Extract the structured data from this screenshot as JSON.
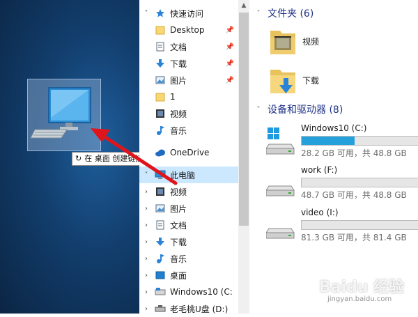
{
  "desktop": {
    "tooltip_glyph": "↻",
    "tooltip_text": "在 桌面 创建链接"
  },
  "nav": {
    "quick_access": "快速访问",
    "pinned": [
      {
        "label": "Desktop",
        "icon": "folder-icon"
      },
      {
        "label": "文档",
        "icon": "document-icon"
      },
      {
        "label": "下载",
        "icon": "download-icon"
      },
      {
        "label": "图片",
        "icon": "pictures-icon"
      }
    ],
    "recent": [
      {
        "label": "1",
        "icon": "folder-icon"
      },
      {
        "label": "视频",
        "icon": "video-icon"
      },
      {
        "label": "音乐",
        "icon": "music-icon"
      }
    ],
    "onedrive": "OneDrive",
    "this_pc": "此电脑",
    "pc_children": [
      {
        "label": "视频",
        "icon": "video-icon"
      },
      {
        "label": "图片",
        "icon": "pictures-icon"
      },
      {
        "label": "文档",
        "icon": "document-icon"
      },
      {
        "label": "下载",
        "icon": "download-icon"
      },
      {
        "label": "音乐",
        "icon": "music-icon"
      },
      {
        "label": "桌面",
        "icon": "desktop-icon"
      },
      {
        "label": "Windows10 (C:",
        "icon": "drive-icon"
      },
      {
        "label": "老毛桃U盘 (D:)",
        "icon": "usb-drive-icon"
      }
    ]
  },
  "content": {
    "folders_header": "文件夹 (6)",
    "folders": [
      {
        "label": "视频",
        "icon": "video-folder-icon"
      },
      {
        "label": "下载",
        "icon": "download-folder-icon"
      }
    ],
    "devices_header": "设备和驱动器 (8)",
    "drives": [
      {
        "name": "Windows10 (C:)",
        "info": "28.2 GB 可用，共 48.8 GB",
        "used_fraction": 0.42,
        "icon": "windows-drive-icon"
      },
      {
        "name": "work (F:)",
        "info": "48.7 GB 可用，共 48.8 GB",
        "used_fraction": 0.0,
        "icon": "hard-drive-icon"
      },
      {
        "name": "video (I:)",
        "info": "81.3 GB 可用，共 81.4 GB",
        "used_fraction": 0.0,
        "icon": "hard-drive-icon"
      }
    ]
  },
  "watermark": {
    "text": "Baidu 经验",
    "sub": "jingyan.baidu.com"
  },
  "colors": {
    "accent": "#26a0da",
    "selected": "#cce8ff",
    "header_blue": "#1e3287",
    "arrow_red": "#e0151b"
  }
}
